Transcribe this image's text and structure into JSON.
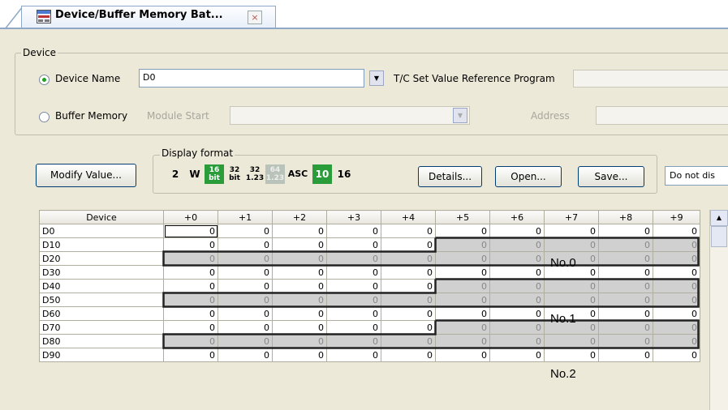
{
  "tab": {
    "title": "Device/Buffer Memory Bat...",
    "close_glyph": "×"
  },
  "device_group": {
    "legend": "Device",
    "device_name_label": "Device Name",
    "device_name_value": "D0",
    "tc_label": "T/C Set Value Reference Program",
    "buffer_memory_label": "Buffer Memory",
    "module_start_label": "Module Start",
    "address_label": "Address"
  },
  "toolbar": {
    "modify_label": "Modify Value...",
    "display_format_legend": "Display format",
    "format_buttons": [
      "2",
      "W",
      "16 bit",
      "32 bit",
      "32 1.23",
      "64 1.23",
      "ASC",
      "10",
      "16"
    ],
    "details_label": "Details...",
    "open_label": "Open...",
    "save_label": "Save...",
    "display_option": "Do not dis"
  },
  "table": {
    "headers": [
      "Device",
      "+0",
      "+1",
      "+2",
      "+3",
      "+4",
      "+5",
      "+6",
      "+7",
      "+8",
      "+9"
    ],
    "rows": [
      {
        "device": "D0",
        "values": [
          "0",
          "0",
          "0",
          "0",
          "0",
          "0",
          "0",
          "0",
          "0",
          "0"
        ]
      },
      {
        "device": "D10",
        "values": [
          "0",
          "0",
          "0",
          "0",
          "0",
          "0",
          "0",
          "0",
          "0",
          "0"
        ]
      },
      {
        "device": "D20",
        "values": [
          "0",
          "0",
          "0",
          "0",
          "0",
          "0",
          "0",
          "0",
          "0",
          "0"
        ]
      },
      {
        "device": "D30",
        "values": [
          "0",
          "0",
          "0",
          "0",
          "0",
          "0",
          "0",
          "0",
          "0",
          "0"
        ]
      },
      {
        "device": "D40",
        "values": [
          "0",
          "0",
          "0",
          "0",
          "0",
          "0",
          "0",
          "0",
          "0",
          "0"
        ]
      },
      {
        "device": "D50",
        "values": [
          "0",
          "0",
          "0",
          "0",
          "0",
          "0",
          "0",
          "0",
          "0",
          "0"
        ]
      },
      {
        "device": "D60",
        "values": [
          "0",
          "0",
          "0",
          "0",
          "0",
          "0",
          "0",
          "0",
          "0",
          "0"
        ]
      },
      {
        "device": "D70",
        "values": [
          "0",
          "0",
          "0",
          "0",
          "0",
          "0",
          "0",
          "0",
          "0",
          "0"
        ]
      },
      {
        "device": "D80",
        "values": [
          "0",
          "0",
          "0",
          "0",
          "0",
          "0",
          "0",
          "0",
          "0",
          "0"
        ]
      },
      {
        "device": "D90",
        "values": [
          "0",
          "0",
          "0",
          "0",
          "0",
          "0",
          "0",
          "0",
          "0",
          "0"
        ]
      }
    ]
  },
  "annotations": [
    "No.0",
    "No.1",
    "No.2"
  ],
  "colors": {
    "shade": "#d0d0d0",
    "format_green": "#2a9d3a",
    "panel": "#ece9d8"
  }
}
